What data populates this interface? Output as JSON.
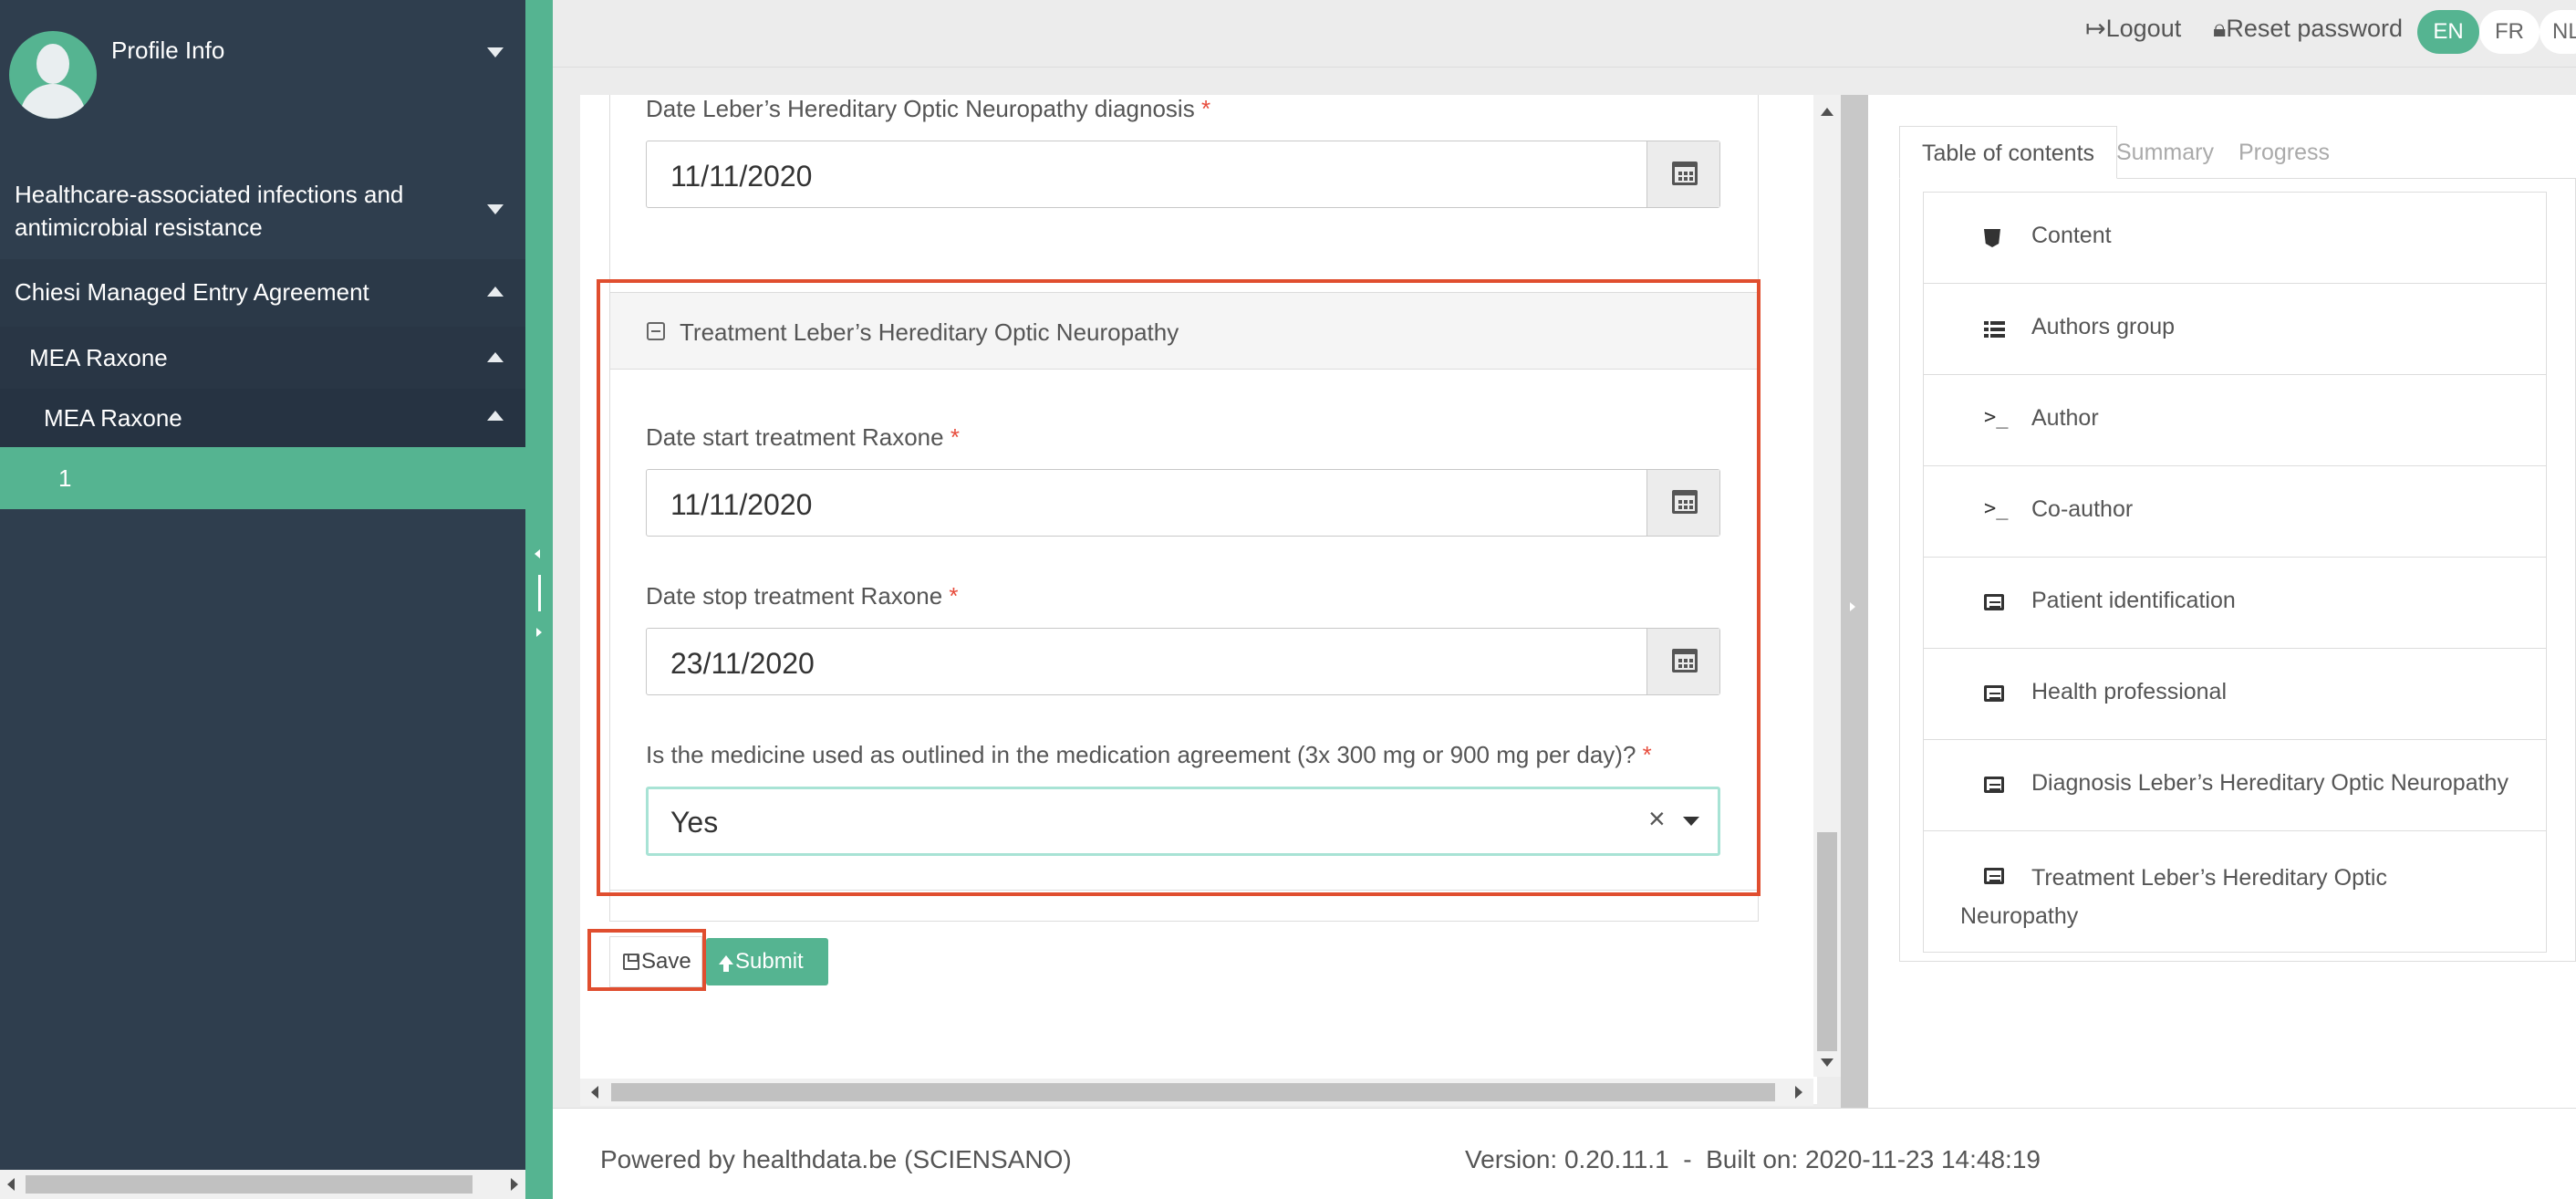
{
  "sidebar": {
    "profile_name": "Profile Info",
    "items": [
      {
        "label": "Healthcare-associated infections and antimicrobial resistance"
      },
      {
        "label": "Chiesi Managed Entry Agreement"
      },
      {
        "label": "MEA Raxone"
      },
      {
        "label": "MEA Raxone"
      },
      {
        "label": "1"
      }
    ]
  },
  "topbar": {
    "logout": "Logout",
    "reset_password": "Reset password",
    "languages": [
      "EN",
      "FR",
      "NL"
    ],
    "active_language": "EN"
  },
  "form": {
    "diagnosis_date_label": "Date Leber’s Hereditary Optic Neuropathy diagnosis",
    "diagnosis_date_value": "11/11/2020",
    "section_title": "Treatment Leber’s Hereditary Optic Neuropathy",
    "start_label": "Date start treatment Raxone",
    "start_value": "11/11/2020",
    "stop_label": "Date stop treatment Raxone",
    "stop_value": "23/11/2020",
    "medicine_label": "Is the medicine used as outlined in the medication agreement (3x 300 mg or 900 mg per day)?",
    "medicine_value": "Yes",
    "required_mark": "*",
    "clear_symbol": "×",
    "save_label": "Save",
    "submit_label": "Submit"
  },
  "right_pane": {
    "tabs": [
      "Table of contents",
      "Summary",
      "Progress"
    ],
    "toc": [
      {
        "label": "Content",
        "icon": "html5-icon"
      },
      {
        "label": "Authors group",
        "icon": "list-icon"
      },
      {
        "label": "Author",
        "icon": "terminal-icon"
      },
      {
        "label": "Co-author",
        "icon": "terminal-icon"
      },
      {
        "label": "Patient identification",
        "icon": "list-alt-icon"
      },
      {
        "label": "Health professional",
        "icon": "list-alt-icon"
      },
      {
        "label": "Diagnosis Leber’s Hereditary Optic Neuropathy",
        "icon": "list-alt-icon"
      },
      {
        "label": "Treatment Leber’s Hereditary Optic Neuropathy",
        "icon": "list-alt-icon"
      }
    ]
  },
  "footer": {
    "powered_by": "Powered by healthdata.be (SCIENSANO)",
    "version": "Version: 0.20.11.1  -  Built on: 2020-11-23 14:48:19"
  },
  "colors": {
    "sidebar_bg": "#2f3e4e",
    "accent_green": "#55b491",
    "highlight_red": "#e04e2f",
    "required_red": "#e74c3c"
  }
}
